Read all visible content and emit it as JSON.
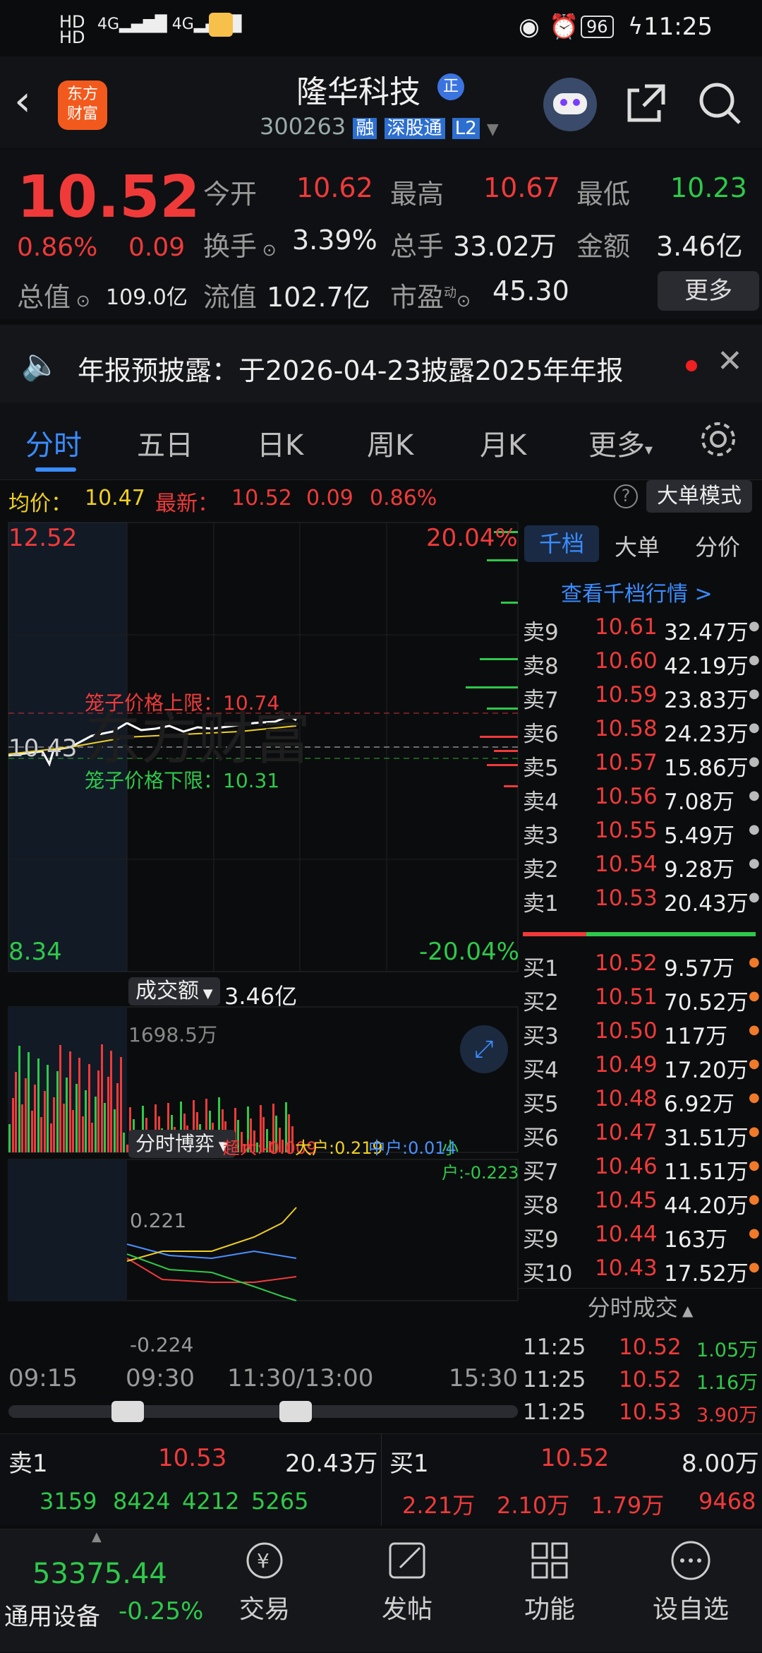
{
  "status": {
    "left_icons": "HD1 HD2 4G 4G signal wifi",
    "right_icons": "eye-icon alarm-icon",
    "battery": "96",
    "time": "11:25"
  },
  "header": {
    "logo_line1": "东方",
    "logo_line2": "财富",
    "stock_name": "隆华科技",
    "badge": "正",
    "code": "300263",
    "tags": [
      "融",
      "深股通",
      "L2"
    ]
  },
  "quote": {
    "price": "10.52",
    "pct": "0.86%",
    "chg": "0.09",
    "row1": [
      {
        "k": "今开",
        "v": "10.62"
      },
      {
        "k": "最高",
        "v": "10.67"
      },
      {
        "k": "最低",
        "v": "10.23"
      }
    ],
    "row2": [
      {
        "k": "换手",
        "v": "3.39%"
      },
      {
        "k": "总手",
        "v": "33.02万"
      },
      {
        "k": "金额",
        "v": "3.46亿"
      }
    ],
    "row3": [
      {
        "k": "总值",
        "v": "109.0亿"
      },
      {
        "k": "流值",
        "v": "102.7亿"
      },
      {
        "k": "市盈",
        "v": "45.30",
        "sup": "动"
      }
    ],
    "more": "更多"
  },
  "notice": {
    "text": "年报预披露：于2026-04-23披露2025年年报"
  },
  "tabs": {
    "items": [
      "分时",
      "五日",
      "日K",
      "周K",
      "月K",
      "更多"
    ]
  },
  "info": {
    "avg_label": "均价：",
    "avg": "10.47",
    "latest_label": "最新：",
    "latest": "10.52",
    "chg": "0.09",
    "pct": "0.86%",
    "mode": "大单模式"
  },
  "chart": {
    "top_price": "12.52",
    "top_pct": "20.04%",
    "mid_price": "10.43",
    "bottom_price": "8.34",
    "bottom_pct": "-20.04%",
    "upper_limit_label": "笼子价格上限：10.74",
    "lower_limit_label": "笼子价格下限：10.31",
    "watermark": "东方财富",
    "vol_label": "成交额",
    "vol_total": "3.46亿",
    "vol_max": "1698.5万",
    "fund_label": "分时博弈",
    "fund_super": "超大:-0.009",
    "fund_big": "大户:0.219",
    "fund_mid": "中户:0.014",
    "fund_small": "小户:-0.223",
    "fund_max": "0.221",
    "fund_min": "-0.224",
    "times": [
      "09:15",
      "09:30",
      "11:30/13:00",
      "15:30"
    ]
  },
  "orderbook": {
    "tabs": [
      "千档",
      "大单",
      "分价"
    ],
    "link": "查看千档行情 >",
    "asks": [
      {
        "l": "卖9",
        "p": "10.61",
        "v": "32.47万"
      },
      {
        "l": "卖8",
        "p": "10.60",
        "v": "42.19万"
      },
      {
        "l": "卖7",
        "p": "10.59",
        "v": "23.83万"
      },
      {
        "l": "卖6",
        "p": "10.58",
        "v": "24.23万"
      },
      {
        "l": "卖5",
        "p": "10.57",
        "v": "15.86万"
      },
      {
        "l": "卖4",
        "p": "10.56",
        "v": "7.08万"
      },
      {
        "l": "卖3",
        "p": "10.55",
        "v": "5.49万"
      },
      {
        "l": "卖2",
        "p": "10.54",
        "v": "9.28万"
      },
      {
        "l": "卖1",
        "p": "10.53",
        "v": "20.43万"
      }
    ],
    "bids": [
      {
        "l": "买1",
        "p": "10.52",
        "v": "9.57万"
      },
      {
        "l": "买2",
        "p": "10.51",
        "v": "70.52万"
      },
      {
        "l": "买3",
        "p": "10.50",
        "v": "117万"
      },
      {
        "l": "买4",
        "p": "10.49",
        "v": "17.20万"
      },
      {
        "l": "买5",
        "p": "10.48",
        "v": "6.92万"
      },
      {
        "l": "买6",
        "p": "10.47",
        "v": "31.51万"
      },
      {
        "l": "买7",
        "p": "10.46",
        "v": "11.51万"
      },
      {
        "l": "买8",
        "p": "10.45",
        "v": "44.20万"
      },
      {
        "l": "买9",
        "p": "10.44",
        "v": "163万"
      },
      {
        "l": "买10",
        "p": "10.43",
        "v": "17.52万"
      }
    ],
    "ticks_label": "分时成交",
    "ticks": [
      {
        "t": "11:25",
        "p": "10.52",
        "v": "1.05万"
      },
      {
        "t": "11:25",
        "p": "10.52",
        "v": "1.16万"
      },
      {
        "t": "11:25",
        "p": "10.53",
        "v": "3.90万"
      }
    ]
  },
  "bottom": {
    "left_label": "卖1",
    "left_price": "10.53",
    "left_vol": "20.43万",
    "left_nums": [
      "3159",
      "8424",
      "4212",
      "5265"
    ],
    "right_label": "买1",
    "right_price": "10.52",
    "right_vol": "8.00万",
    "right_nums": [
      "2.21万",
      "2.10万",
      "1.79万",
      "9468"
    ]
  },
  "nav": {
    "index_value": "53375.44",
    "index_name": "通用设备",
    "index_chg": "-0.25%",
    "items": [
      "交易",
      "发帖",
      "功能",
      "设自选"
    ]
  }
}
